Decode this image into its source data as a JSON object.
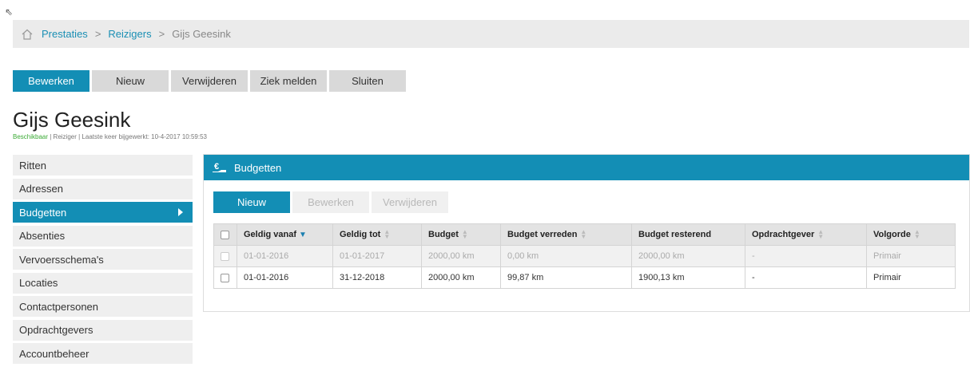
{
  "breadcrumb": {
    "items": [
      "Prestaties",
      "Reizigers"
    ],
    "current": "Gijs Geesink",
    "separator": ">"
  },
  "toolbar": {
    "buttons": [
      "Bewerken",
      "Nieuw",
      "Verwijderen",
      "Ziek melden",
      "Sluiten"
    ]
  },
  "page": {
    "title": "Gijs Geesink",
    "status": "Beschikbaar",
    "meta": " | Reiziger | Laatste keer bijgewerkt: 10-4-2017 10:59:53"
  },
  "sidebar": {
    "items": [
      "Ritten",
      "Adressen",
      "Budgetten",
      "Absenties",
      "Vervoersschema's",
      "Locaties",
      "Contactpersonen",
      "Opdrachtgevers",
      "Accountbeheer"
    ],
    "active": "Budgetten"
  },
  "panel": {
    "title": "Budgetten",
    "buttons": [
      "Nieuw",
      "Bewerken",
      "Verwijderen"
    ],
    "columns": [
      "Geldig vanaf",
      "Geldig tot",
      "Budget",
      "Budget verreden",
      "Budget resterend",
      "Opdrachtgever",
      "Volgorde"
    ],
    "rows": [
      [
        "01-01-2016",
        "01-01-2017",
        "2000,00 km",
        "0,00 km",
        "2000,00 km",
        "-",
        "Primair"
      ],
      [
        "01-01-2016",
        "31-12-2018",
        "2000,00 km",
        "99,87 km",
        "1900,13 km",
        "-",
        "Primair"
      ]
    ]
  },
  "colors": {
    "accent": "#138eb5",
    "status_ok": "#3aaa35"
  }
}
